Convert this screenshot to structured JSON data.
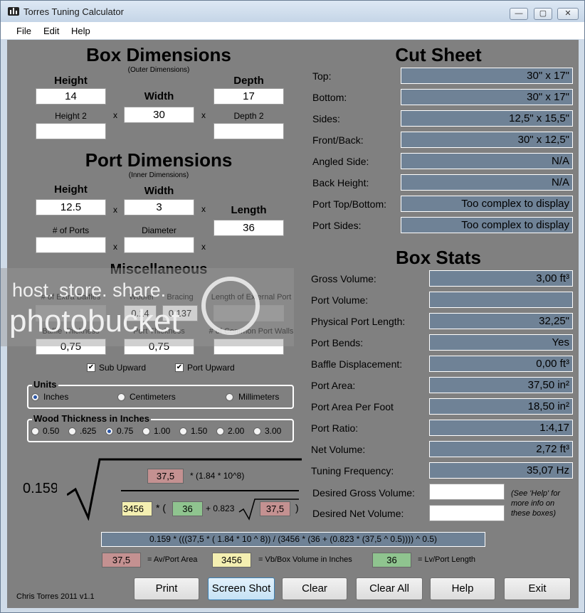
{
  "window": {
    "title": "Torres Tuning Calculator",
    "min": "—",
    "max": "▢",
    "close": "✕"
  },
  "menu": [
    "File",
    "Edit",
    "Help"
  ],
  "box": {
    "title": "Box Dimensions",
    "subtitle": "(Outer Dimensions)",
    "height_label": "Height",
    "width_label": "Width",
    "depth_label": "Depth",
    "height2_label": "Height 2",
    "depth2_label": "Depth 2",
    "height": "14",
    "width": "30",
    "depth": "17",
    "height2": "",
    "depth2": ""
  },
  "port": {
    "title": "Port Dimensions",
    "subtitle": "(Inner Dimensions)",
    "height_label": "Height",
    "width_label": "Width",
    "length_label": "Length",
    "ports_label": "# of Ports",
    "diameter_label": "Diameter",
    "height": "12.5",
    "width": "3",
    "length": "36",
    "ports": "",
    "diameter": ""
  },
  "misc": {
    "title": "Miscellaneous",
    "extra_baffles_label": "# of Extra Baffles",
    "woofer_label": "Woofer",
    "bracing_label": "Bracing",
    "ext_port_label": "Length of External Port",
    "woofer": "0.14",
    "bracing": "0.137",
    "baffle_thick_label": "Baffle Thickness",
    "port_thick_label": "Port Thickness",
    "common_walls_label": "# of Common Port Walls",
    "baffle_thick": "0,75",
    "port_thick": "0,75",
    "sub_upward": "Sub Upward",
    "port_upward": "Port Upward"
  },
  "units": {
    "title": "Units",
    "options": [
      "Inches",
      "Centimeters",
      "Millimeters"
    ],
    "selected": "Inches"
  },
  "wood": {
    "title": "Wood Thickness in Inches",
    "options": [
      "0.50",
      ".625",
      "0.75",
      "1.00",
      "1.50",
      "2.00",
      "3.00"
    ],
    "selected": "0.75"
  },
  "cut": {
    "title": "Cut Sheet",
    "rows": [
      {
        "label": "Top:",
        "value": "30\" x 17\""
      },
      {
        "label": "Bottom:",
        "value": "30\" x 17\""
      },
      {
        "label": "Sides:",
        "value": "12,5\" x 15,5\""
      },
      {
        "label": "Front/Back:",
        "value": "30\" x 12,5\""
      },
      {
        "label": "Angled Side:",
        "value": "N/A"
      },
      {
        "label": "Back Height:",
        "value": "N/A"
      },
      {
        "label": "Port Top/Bottom:",
        "value": "Too complex to display"
      },
      {
        "label": "Port Sides:",
        "value": "Too complex to display"
      }
    ]
  },
  "stats": {
    "title": "Box Stats",
    "rows": [
      {
        "label": "Gross Volume:",
        "value": "3,00 ft³"
      },
      {
        "label": "Port Volume:",
        "value": ""
      },
      {
        "label": "Physical Port Length:",
        "value": "32,25\""
      },
      {
        "label": "Port Bends:",
        "value": "Yes"
      },
      {
        "label": "Baffle Displacement:",
        "value": "0,00 ft³"
      },
      {
        "label": "Port Area:",
        "value": "37,50 in²"
      },
      {
        "label": "Port Area Per Foot",
        "value": "18,50 in²"
      },
      {
        "label": "Port Ratio:",
        "value": "1:4,17"
      },
      {
        "label": "Net Volume:",
        "value": "2,72 ft³"
      },
      {
        "label": "Tuning Frequency:",
        "value": "35,07 Hz"
      }
    ],
    "desired_gross_label": "Desired Gross Volume:",
    "desired_net_label": "Desired Net Volume:",
    "desired_gross": "",
    "desired_net": "",
    "hint": "(See 'Help' for more info on these boxes)"
  },
  "formula": {
    "const": "0.159",
    "av": "37,5",
    "mult": "* (1.84 * 10^8)",
    "vb": "3456",
    "lv": "36",
    "plus": "+ 0.823",
    "av2": "37,5",
    "open": "* (",
    "close": ")",
    "full": "0.159 * (((37,5 * ( 1.84 * 10 ^ 8)) / (3456 * (36 + (0.823 * (37,5 ^ 0.5)))) ^ 0.5)",
    "legend": [
      {
        "value": "37,5",
        "label": "= Av/Port Area"
      },
      {
        "value": "3456",
        "label": "= Vb/Box Volume in Inches"
      },
      {
        "value": "36",
        "label": "= Lv/Port Length"
      }
    ]
  },
  "credit": "Chris Torres 2011 v1.1",
  "buttons": [
    "Print",
    "Screen Shot",
    "Clear",
    "Clear All",
    "Help",
    "Exit"
  ],
  "watermark": {
    "line1": "host. store. share.",
    "line2": "photobucket"
  }
}
